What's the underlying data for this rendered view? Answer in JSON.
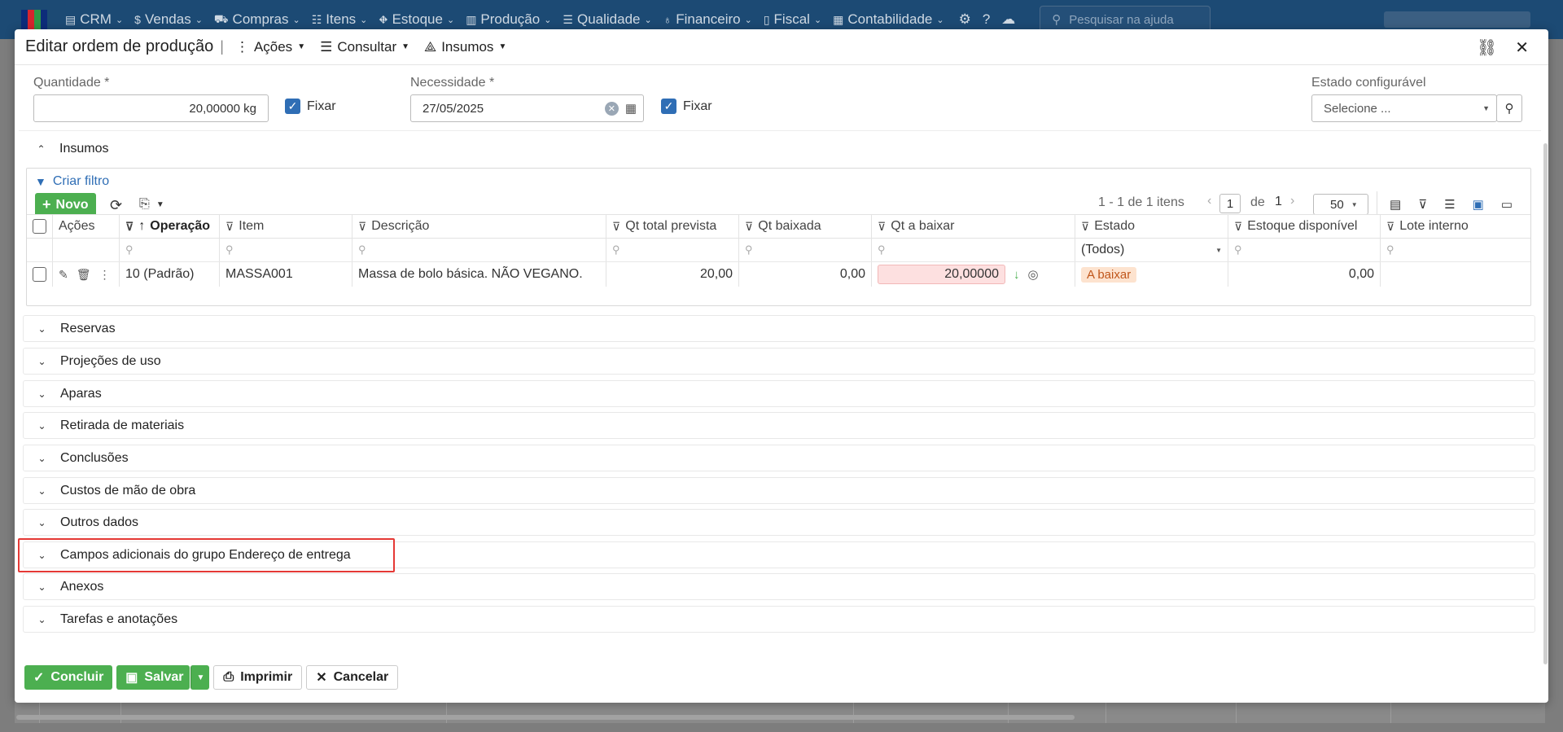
{
  "nav": {
    "items": [
      {
        "label": "CRM",
        "icon": "crm-icon"
      },
      {
        "label": "Vendas",
        "icon": "sales-icon"
      },
      {
        "label": "Compras",
        "icon": "cart-icon"
      },
      {
        "label": "Itens",
        "icon": "items-icon"
      },
      {
        "label": "Estoque",
        "icon": "stock-icon"
      },
      {
        "label": "Produção",
        "icon": "factory-icon"
      },
      {
        "label": "Qualidade",
        "icon": "quality-icon"
      },
      {
        "label": "Financeiro",
        "icon": "finance-icon"
      },
      {
        "label": "Fiscal",
        "icon": "fiscal-icon"
      },
      {
        "label": "Contabilidade",
        "icon": "accounting-icon"
      }
    ],
    "help_search_placeholder": "Pesquisar na ajuda"
  },
  "modal": {
    "title": "Editar ordem de produção",
    "title_separator": "|",
    "menus": {
      "acoes": "Ações",
      "consultar": "Consultar",
      "insumos": "Insumos"
    }
  },
  "form": {
    "quantidade_label": "Quantidade *",
    "quantidade_value": "20,00000 kg",
    "fixar1_label": "Fixar",
    "necessidade_label": "Necessidade *",
    "necessidade_value": "27/05/2025",
    "fixar2_label": "Fixar",
    "estado_label": "Estado configurável",
    "estado_placeholder": "Selecione ..."
  },
  "insumos": {
    "section_title": "Insumos",
    "create_filter": "Criar filtro",
    "new_button": "Novo",
    "pager": {
      "summary": "1 - 1 de 1 itens",
      "page": "1",
      "of": "de",
      "total_pages": "1",
      "page_size": "50"
    },
    "columns": [
      "Ações",
      "Operação",
      "Item",
      "Descrição",
      "Qt total prevista",
      "Qt baixada",
      "Qt a baixar",
      "Estado",
      "Estoque disponível",
      "Lote interno"
    ],
    "estado_filter": "(Todos)",
    "rows": [
      {
        "operacao": "10 (Padrão)",
        "item": "MASSA001",
        "descricao": "Massa de bolo básica. NÃO VEGANO.",
        "qt_total_prevista": "20,00",
        "qt_baixada": "0,00",
        "qt_a_baixar": "20,00000",
        "estado": "A baixar",
        "estoque_disponivel": "0,00",
        "lote_interno": ""
      }
    ]
  },
  "sections": [
    "Reservas",
    "Projeções de uso",
    "Aparas",
    "Retirada de materiais",
    "Conclusões",
    "Custos de mão de obra",
    "Outros dados",
    "Campos adicionais do grupo Endereço de entrega",
    "Anexos",
    "Tarefas e anotações"
  ],
  "footer": {
    "concluir": "Concluir",
    "salvar": "Salvar",
    "imprimir": "Imprimir",
    "cancelar": "Cancelar"
  },
  "colors": {
    "header_bg": "#1c4a74",
    "primary": "#2f6eb5",
    "success": "#4caf50",
    "highlight": "#e53935",
    "estado_badge_bg": "#fde3cf",
    "estado_badge_text": "#c0561a",
    "qty_highlight_bg": "#fde0e0"
  }
}
